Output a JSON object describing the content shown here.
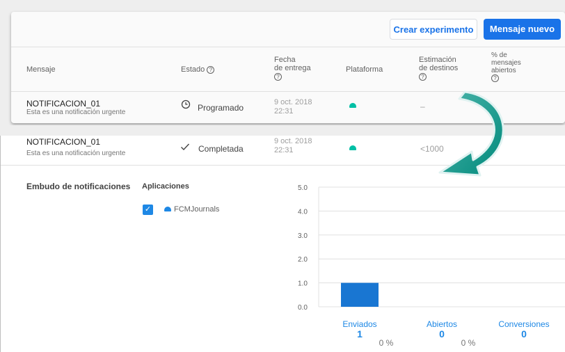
{
  "toolbar": {
    "create_experiment": "Crear experimento",
    "new_message": "Mensaje nuevo"
  },
  "table": {
    "headers": {
      "message": "Mensaje",
      "status": "Estado",
      "delivery_date_line1": "Fecha",
      "delivery_date_line2": "de entrega",
      "platform": "Plataforma",
      "recipients_line1": "Estimación",
      "recipients_line2": "de destinos",
      "opened_line1": "% de",
      "opened_line2": "mensajes",
      "opened_line3": "abiertos"
    },
    "help_glyph": "?",
    "rows": [
      {
        "title": "NOTIFICACION_01",
        "subtitle": "Esta es una notificación urgente",
        "status_icon": "clock-icon",
        "status": "Programado",
        "date_line1": "9 oct. 2018",
        "date_line2": "22:31",
        "platform_icon": "android-icon",
        "recipients": "–",
        "opened": "–"
      },
      {
        "title": "NOTIFICACION_01",
        "subtitle": "Esta es una notificación urgente",
        "status_icon": "checkmark-icon",
        "status": "Completada",
        "date_line1": "9 oct. 2018",
        "date_line2": "22:31",
        "platform_icon": "android-icon",
        "recipients": "<1000",
        "opened": "–"
      }
    ]
  },
  "funnel": {
    "title": "Embudo de notificaciones",
    "apps_label": "Aplicaciones",
    "app_name": "FCMJournals",
    "checkbox_glyph": "✓"
  },
  "chart_data": {
    "type": "bar",
    "categories": [
      "Enviados",
      "Abiertos",
      "Conversiones"
    ],
    "values": [
      1,
      0,
      0
    ],
    "percentages": [
      "0 %",
      "0 %"
    ],
    "ylim": [
      0,
      5
    ],
    "yticks": [
      "0.0",
      "1.0",
      "2.0",
      "3.0",
      "4.0",
      "5.0"
    ],
    "bar_color": "#1976d2",
    "label_color": "#1e88e5",
    "grid": true
  },
  "colors": {
    "accent": "#1a73e8",
    "android": "#00bfa5",
    "arrow": "#26a69a"
  }
}
